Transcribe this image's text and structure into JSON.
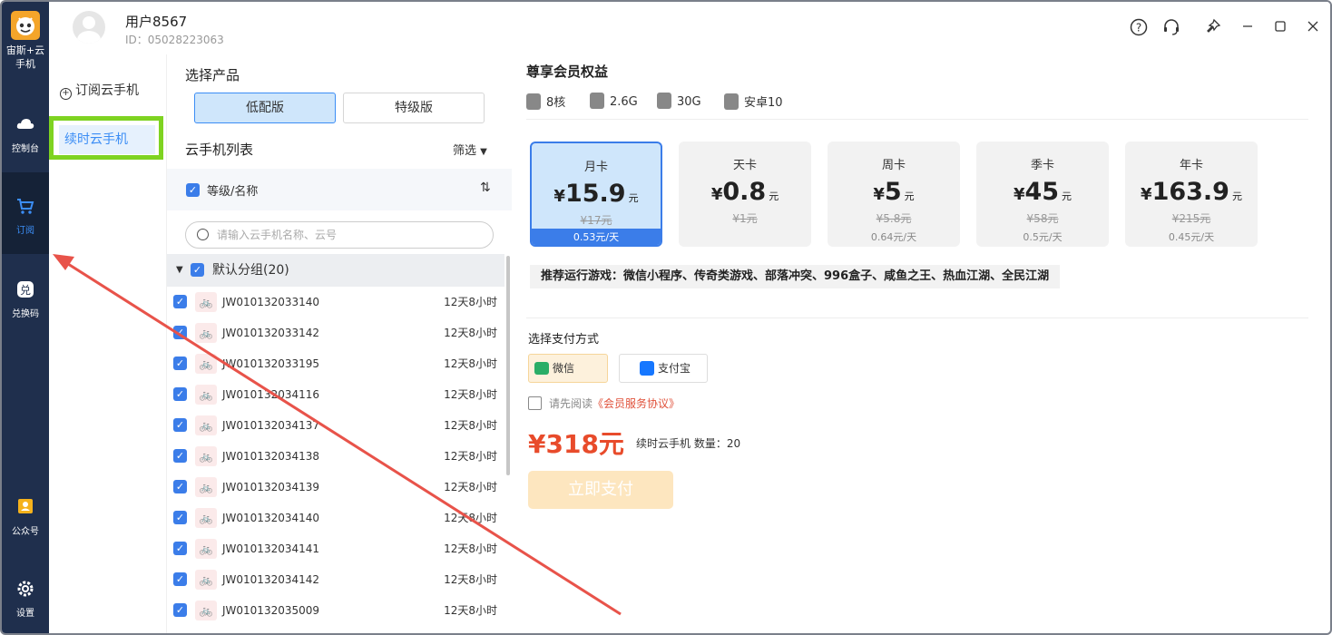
{
  "rail": {
    "logo_label": "宙斯+云手机",
    "items": [
      {
        "label": "控制台",
        "icon": "cloud-icon"
      },
      {
        "label": "订阅",
        "icon": "cart-icon"
      },
      {
        "label": "兑换码",
        "icon": "redeem-icon"
      },
      {
        "label": "公众号",
        "icon": "official-account-icon"
      },
      {
        "label": "设置",
        "icon": "gear-icon"
      }
    ]
  },
  "header": {
    "username": "用户8567",
    "user_id": "ID：05028223063"
  },
  "nav": {
    "subscribe": "订阅云手机",
    "renew": "续时云手机"
  },
  "product": {
    "title": "选择产品",
    "versions": [
      "低配版",
      "特级版"
    ]
  },
  "list": {
    "title": "云手机列表",
    "filter": "筛选",
    "header": "等级/名称",
    "search_placeholder": "请输入云手机名称、云号",
    "group": "默认分组(20)",
    "rows": [
      {
        "id": "JW010132033140",
        "time": "12天8小时"
      },
      {
        "id": "JW010132033142",
        "time": "12天8小时"
      },
      {
        "id": "JW010132033195",
        "time": "12天8小时"
      },
      {
        "id": "JW010132034116",
        "time": "12天8小时"
      },
      {
        "id": "JW010132034137",
        "time": "12天8小时"
      },
      {
        "id": "JW010132034138",
        "time": "12天8小时"
      },
      {
        "id": "JW010132034139",
        "time": "12天8小时"
      },
      {
        "id": "JW010132034140",
        "time": "12天8小时"
      },
      {
        "id": "JW010132034141",
        "time": "12天8小时"
      },
      {
        "id": "JW010132034142",
        "time": "12天8小时"
      },
      {
        "id": "JW010132035009",
        "time": "12天8小时"
      }
    ]
  },
  "benefits": {
    "title": "尊享会员权益",
    "specs": [
      "8核",
      "2.6G",
      "30G",
      "安卓10"
    ]
  },
  "cards": [
    {
      "name": "月卡",
      "price": "15.9",
      "unit": "元",
      "orig": "¥17元",
      "day": "0.53元/天",
      "selected": true
    },
    {
      "name": "天卡",
      "price": "0.8",
      "unit": "元",
      "orig": "¥1元",
      "day": "",
      "selected": false
    },
    {
      "name": "周卡",
      "price": "5",
      "unit": "元",
      "orig": "¥5.8元",
      "day": "0.64元/天",
      "selected": false
    },
    {
      "name": "季卡",
      "price": "45",
      "unit": "元",
      "orig": "¥58元",
      "day": "0.5元/天",
      "selected": false
    },
    {
      "name": "年卡",
      "price": "163.9",
      "unit": "元",
      "orig": "¥215元",
      "day": "0.45元/天",
      "selected": false
    }
  ],
  "currency": "¥",
  "recommend": "推荐运行游戏：微信小程序、传奇类游戏、部落冲突、996盒子、咸鱼之王、热血江湖、全民江湖",
  "payment": {
    "title": "选择支付方式",
    "wechat": "微信",
    "alipay": "支付宝",
    "agree_prefix": "请先阅读",
    "agree_link": "《会员服务协议》",
    "total": "¥318元",
    "total_desc": "续时云手机 数量：20",
    "pay_now": "立即支付"
  },
  "colors": {
    "rail_bg": "#1f2f4d",
    "accent": "#3b7de9",
    "highlight_box": "#7ed321",
    "price_red": "#e84b2b",
    "annotation_arrow": "#e8534a"
  }
}
